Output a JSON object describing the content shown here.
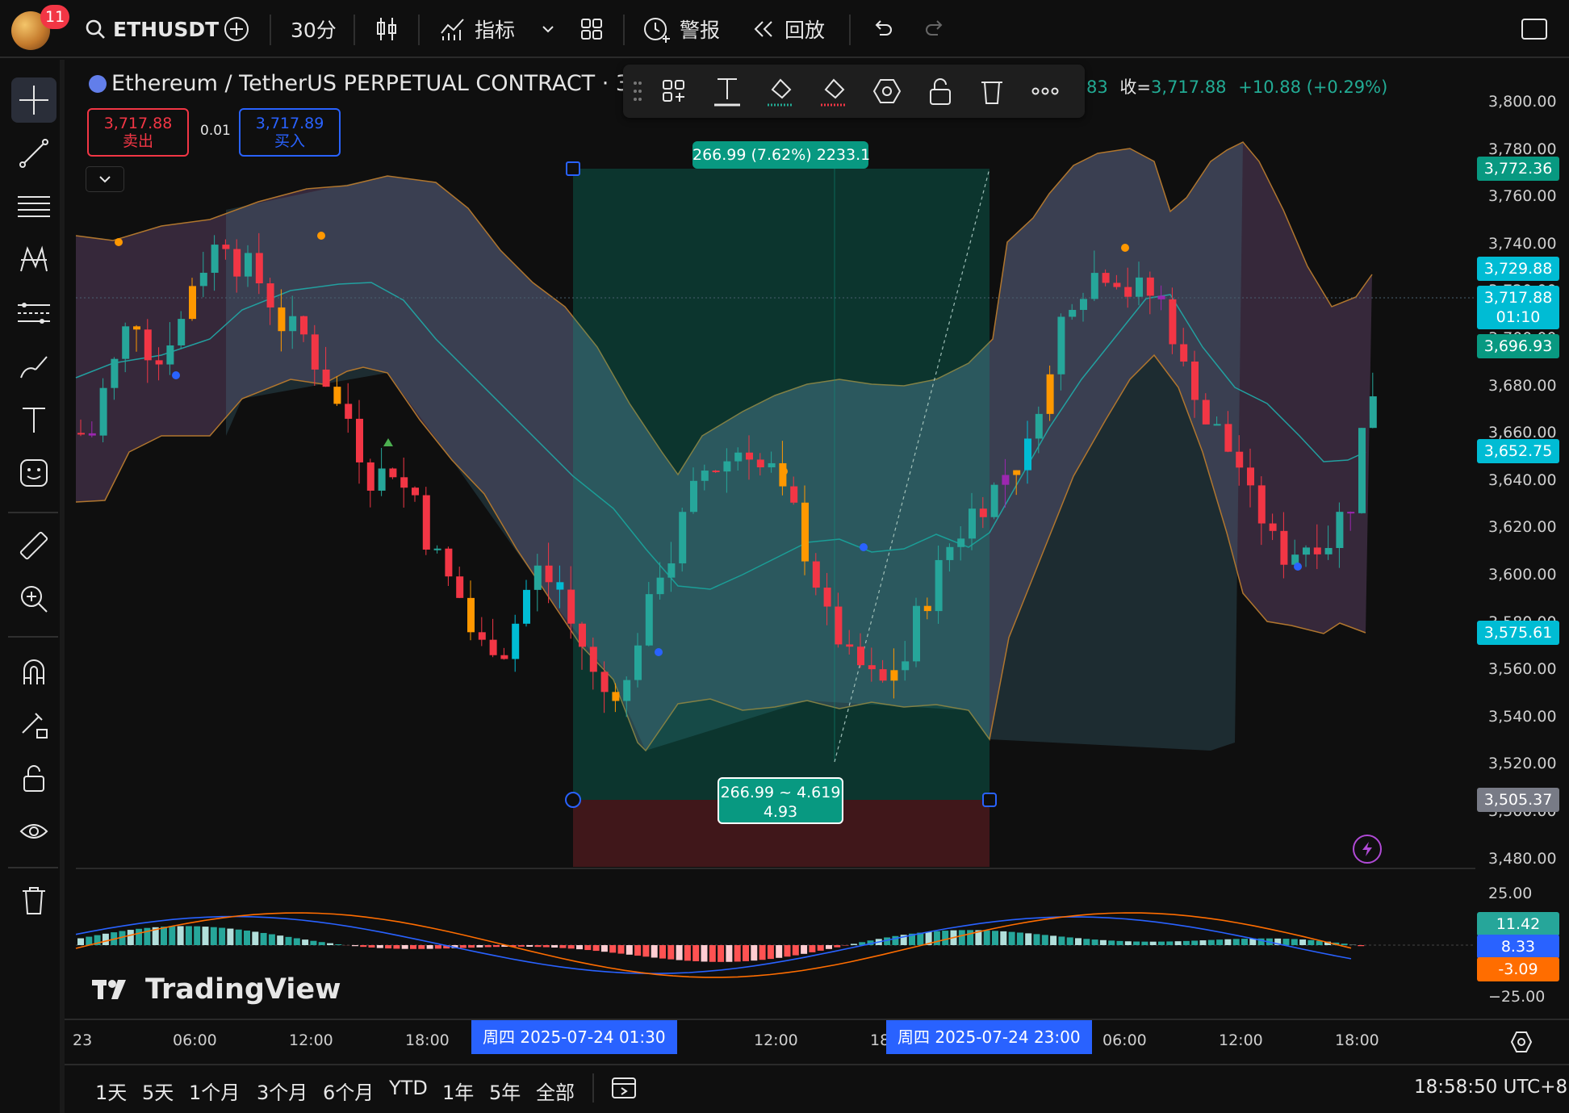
{
  "topbar": {
    "badge_count": "11",
    "symbol": "ETHUSDT",
    "interval": "30分",
    "indicators_label": "指标",
    "alert_label": "警报",
    "replay_label": "回放"
  },
  "legend": {
    "title": "Ethereum / TetherUS PERPETUAL CONTRACT · 30 ·",
    "tail_partial": "83",
    "close_label": "收=",
    "close_value": "3,717.88",
    "change": "+10.88 (+0.29%)"
  },
  "trade": {
    "sell_price": "3,717.88",
    "sell_label": "卖出",
    "spread": "0.01",
    "buy_price": "3,717.89",
    "buy_label": "买入"
  },
  "measure": {
    "top_label": "266.99 (7.62%) 2233.1",
    "bottom_line1": "266.99 ~ 4.619",
    "bottom_line2": "4.93"
  },
  "price_axis": {
    "ticks": [
      "3,800.00",
      "3,780.00",
      "3,760.00",
      "3,740.00",
      "3,720.00",
      "3,700.00",
      "3,680.00",
      "3,660.00",
      "3,640.00",
      "3,620.00",
      "3,600.00",
      "3,580.00",
      "3,560.00",
      "3,540.00",
      "3,520.00",
      "3,500.00",
      "3,480.00"
    ],
    "tags": {
      "t1": "3,772.36",
      "t2": "3,729.88",
      "t3a": "3,717.88",
      "t3b": "01:10",
      "t4": "3,696.93",
      "t5": "3,652.75",
      "t6": "3,575.61",
      "t7": "3,505.37"
    }
  },
  "macd": {
    "ticks": [
      "25.00",
      "−25.00"
    ],
    "hist": "11.42",
    "macd": "8.33",
    "signal": "-3.09"
  },
  "watermark": "TradingView",
  "time_axis": {
    "labels": [
      "23",
      "06:00",
      "12:00",
      "18:00",
      "12:00",
      "18",
      "06:00",
      "12:00",
      "18:00"
    ],
    "sel_start": "周四 2025-07-24   01:30",
    "sel_end": "周四 2025-07-24   23:00"
  },
  "bottombar": {
    "ranges": [
      "1天",
      "5天",
      "1个月",
      "3个月",
      "6个月",
      "YTD",
      "1年",
      "5年",
      "全部"
    ],
    "clock": "18:58:50 UTC+8"
  },
  "colors": {
    "up": "#26a69a",
    "down": "#f23645",
    "teal": "#22ab94",
    "blue": "#2962ff",
    "orange": "#ff9800"
  },
  "icons": [
    "search-icon",
    "plus-circle-icon",
    "candle-icon",
    "indicator-icon",
    "layout-icon",
    "alert-icon",
    "replay-icon",
    "undo-icon",
    "redo-icon",
    "fullscreen-icon"
  ]
}
